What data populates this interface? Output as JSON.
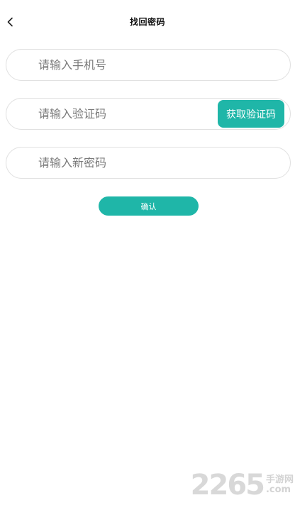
{
  "header": {
    "title": "找回密码",
    "back_icon": "chevron-left-icon"
  },
  "form": {
    "phone_placeholder": "请输入手机号",
    "code_placeholder": "请输入验证码",
    "get_code_label": "获取验证码",
    "new_password_placeholder": "请输入新密码",
    "confirm_label": "确认"
  },
  "watermark": {
    "number": "2265",
    "site_cn": "手游网",
    "site_suffix": ".com"
  },
  "colors": {
    "accent": "#1fb6a8",
    "field_border": "#e1e1e1",
    "placeholder": "#7a7a7a"
  }
}
